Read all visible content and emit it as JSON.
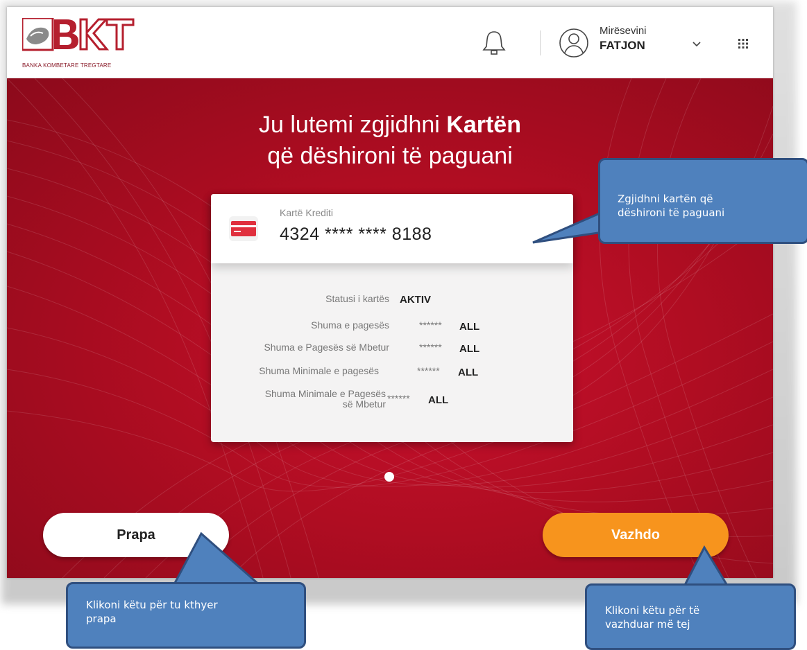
{
  "header": {
    "logo_letters": "BKT",
    "logo_subtitle": "BANKA KOMBETARE TREGTARE",
    "greeting": "Mirësevini",
    "user_name": "FATJON"
  },
  "title": {
    "line1_prefix": "Ju lutemi zgjidhni ",
    "line1_bold": "Kartën",
    "line2": "që dëshironi të paguani"
  },
  "card": {
    "type_label": "Kartë Krediti",
    "number": "4324 **** **** 8188",
    "rows": [
      {
        "label": "Statusi i kartës",
        "value": "AKTIV"
      },
      {
        "label": "Shuma e pagesës",
        "value": "******",
        "currency": "ALL"
      },
      {
        "label": "Shuma e Pagesës së Mbetur",
        "value": "******",
        "currency": "ALL"
      },
      {
        "label": "Shuma Minimale e pagesës",
        "value": "******",
        "currency": "ALL"
      },
      {
        "label_line1": "Shuma Minimale e Pagesës",
        "label_line2": "së Mbetur",
        "value": "******",
        "currency": "ALL"
      }
    ]
  },
  "buttons": {
    "back": "Prapa",
    "next": "Vazhdo"
  },
  "callouts": {
    "card": {
      "line1": "Zgjidhni kartën që",
      "line2": "dëshironi të paguani"
    },
    "back": {
      "line1": "Klikoni këtu për tu kthyer",
      "line2": "prapa"
    },
    "next": {
      "line1": "Klikoni këtu për të",
      "line2": "vazhduar më tej"
    }
  },
  "colors": {
    "brand_red": "#c8102e",
    "accent_orange": "#f7941d",
    "callout_blue": "#4f81bd"
  }
}
